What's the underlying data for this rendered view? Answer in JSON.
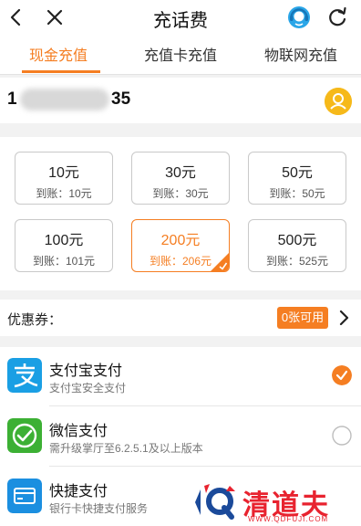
{
  "header": {
    "title": "充话费"
  },
  "tabs": [
    {
      "label": "现金充值"
    },
    {
      "label": "充值卡充值"
    },
    {
      "label": "物联网充值"
    }
  ],
  "phone": {
    "prefix": "1",
    "suffix": "35"
  },
  "amounts": [
    {
      "value": "10元",
      "credit": "到账：10元"
    },
    {
      "value": "30元",
      "credit": "到账：30元"
    },
    {
      "value": "50元",
      "credit": "到账：50元"
    },
    {
      "value": "100元",
      "credit": "到账：101元"
    },
    {
      "value": "200元",
      "credit": "到账：206元",
      "selected": true
    },
    {
      "value": "500元",
      "credit": "到账：525元"
    }
  ],
  "coupon": {
    "label": "优惠券：",
    "badge": "0张可用"
  },
  "payments": [
    {
      "name": "支付宝支付",
      "desc": "支付宝安全支付",
      "selected": true
    },
    {
      "name": "微信支付",
      "desc": "需升级掌厅至6.2.5.1及以上版本",
      "selected": false
    },
    {
      "name": "快捷支付",
      "desc": "银行卡快捷支付服务",
      "selected": false
    }
  ],
  "watermark": {
    "text": "清道夫",
    "url": "WWW.QDFUJI.COM"
  },
  "colors": {
    "accent": "#f57e22",
    "alipay": "#1a9fe4",
    "wechat": "#3cb034",
    "quickpay": "#1b8fe0",
    "avatar": "#f6b91a"
  }
}
